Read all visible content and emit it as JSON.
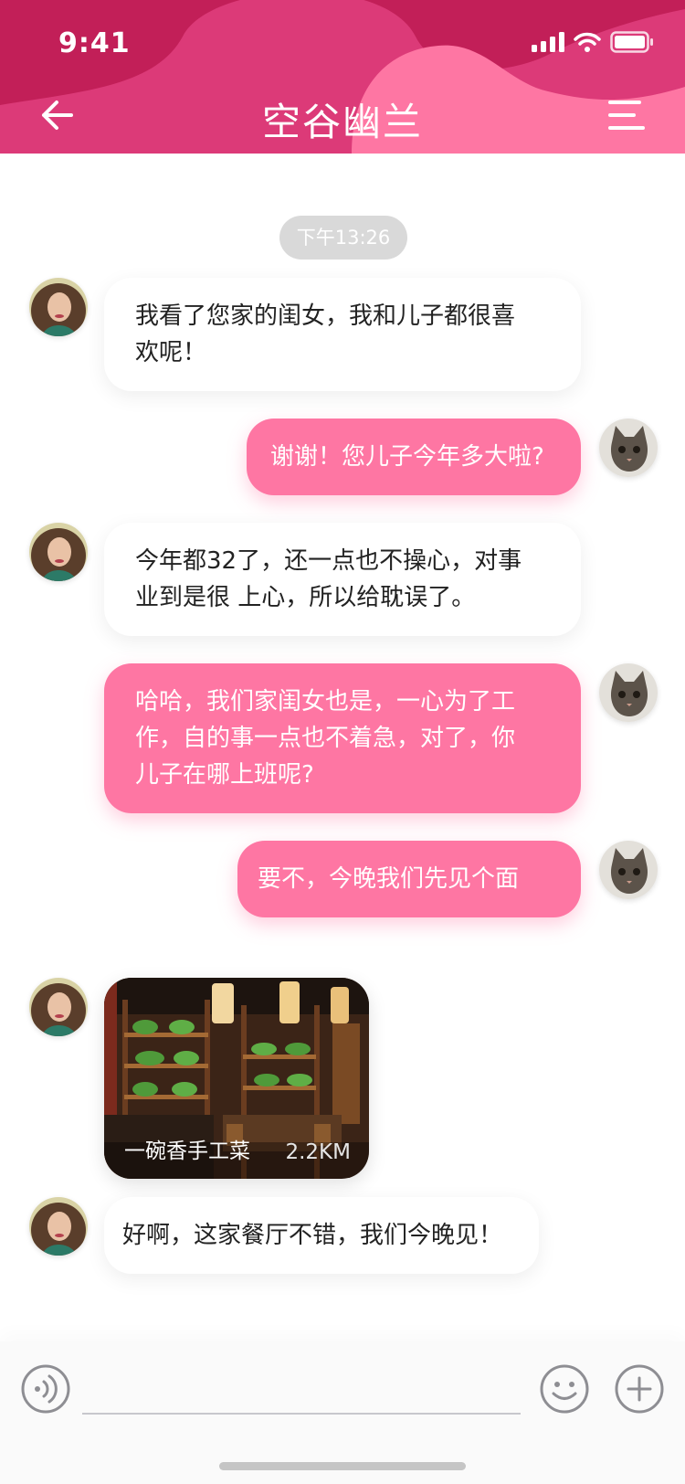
{
  "status_bar": {
    "time": "9:41"
  },
  "header": {
    "title": "空谷幽兰",
    "back_icon": "arrow-left-icon",
    "menu_icon": "menu-icon"
  },
  "colors": {
    "header_dark": "#c21f58",
    "header_mid": "#dc3a78",
    "header_light": "#fe76a3",
    "bubble_out": "#fe76a3",
    "time_pill": "#d9d9d9"
  },
  "chat": {
    "timestamp": "下午13:26",
    "messages": [
      {
        "side": "in",
        "lines": [
          "我看了您家的闺女，我和儿子都很喜",
          "欢呢！"
        ]
      },
      {
        "side": "out",
        "lines": [
          "谢谢！您儿子今年多大啦?"
        ]
      },
      {
        "side": "in",
        "lines": [
          "今年都32了，还一点也不操心，对事",
          "业到是很 上心，所以给耽误了。"
        ]
      },
      {
        "side": "out",
        "lines": [
          "哈哈，我们家闺女也是，一心为了工",
          "作，自的事一点也不着急，对了，你",
          "儿子在哪上班呢?"
        ]
      },
      {
        "side": "out",
        "lines": [
          "要不，今晚我们先见个面"
        ]
      },
      {
        "side": "in",
        "card": {
          "name": "一碗香手工菜",
          "distance": "2.2KM"
        }
      },
      {
        "side": "in",
        "lines": [
          "好啊，这家餐厅不错，我们今晚见！"
        ]
      }
    ]
  },
  "input_bar": {
    "placeholder": "",
    "voice_icon": "voice-icon",
    "emoji_icon": "emoji-icon",
    "plus_icon": "plus-icon"
  }
}
